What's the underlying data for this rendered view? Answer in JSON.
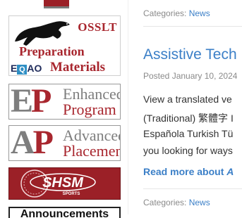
{
  "sidebar": {
    "osslt": {
      "line1": "OSSLT",
      "line2": "Preparation",
      "logo_e": "E",
      "logo_q": "Q",
      "logo_ao": "AO",
      "line3": "Materials"
    },
    "ep": {
      "letters_gray": "E",
      "letters_red": "P",
      "line1": "Enhanced",
      "line2": "Program"
    },
    "ap": {
      "letters_gray": "A",
      "letters_red": "P",
      "line1": "Advanced",
      "line2": "Placement"
    },
    "shsm": {
      "label": "SHSM",
      "sub": "SPORTS"
    },
    "announcements": "Announcements"
  },
  "posts": {
    "prev_categories_label": "Categories:",
    "prev_category": "News",
    "title": "Assistive Tech",
    "posted": "Posted January 10, 2024",
    "body": [
      "View a translated ve",
      "(Traditional) 繁體字 I",
      "Española Turkish Tü",
      "you looking for ways"
    ],
    "read_more_prefix": "Read more about ",
    "read_more_italic": "A",
    "next_categories_label": "Categories:",
    "next_category": "News"
  },
  "colors": {
    "brand_red": "#9b2027",
    "link_blue": "#3b7fc7"
  }
}
